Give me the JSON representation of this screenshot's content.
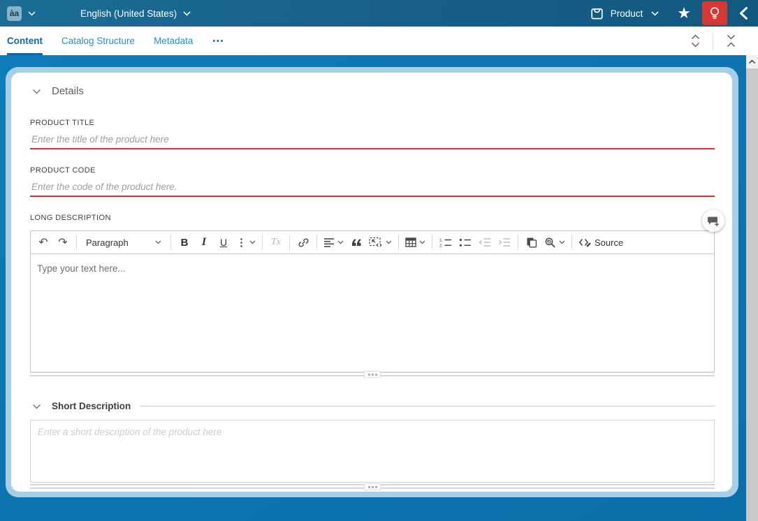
{
  "topbar": {
    "language_icon_text": "àa",
    "language_label": "English (United States)",
    "entity_label": "Product"
  },
  "tabbar": {
    "tabs": [
      {
        "label": "Content"
      },
      {
        "label": "Catalog Structure"
      },
      {
        "label": "Metadata"
      }
    ],
    "more_label": "⋯"
  },
  "details": {
    "title": "Details",
    "product_title": {
      "label": "PRODUCT TITLE",
      "placeholder": "Enter the title of the product here"
    },
    "product_code": {
      "label": "PRODUCT CODE",
      "placeholder": "Enter the code of the product here."
    },
    "long_description": {
      "label": "LONG DESCRIPTION",
      "toolbar": {
        "paragraph_label": "Paragraph",
        "source_label": "Source"
      },
      "placeholder": "Type your text here..."
    }
  },
  "short_description": {
    "title": "Short Description",
    "placeholder": "Enter a short description of the product here"
  },
  "editor_glyphs": {
    "bold": "B",
    "italic": "I",
    "underline": "U",
    "more": "⋮",
    "remove_format": "Tx",
    "undo": "↶",
    "redo": "↷"
  },
  "colors": {
    "topbar_blue": "#18688f",
    "content_blue": "#0c74b0",
    "frame_light_blue": "#a6cfe7",
    "required_red": "#bf3a2e",
    "highlight_button_red": "#d93732",
    "active_tab_blue": "#17649e",
    "inactive_tab_blue": "#2d8cc4"
  }
}
